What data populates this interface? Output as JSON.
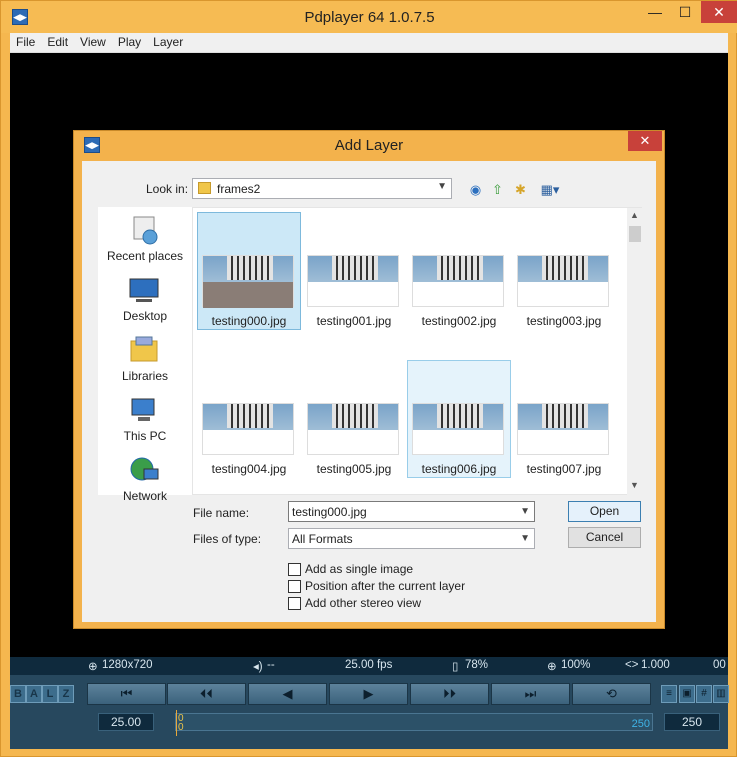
{
  "window": {
    "title": "Pdplayer 64 1.0.7.5",
    "controls": {
      "minimize": "—",
      "maximize": "☐",
      "close": "✕"
    }
  },
  "menu": [
    "File",
    "Edit",
    "View",
    "Play",
    "Layer"
  ],
  "status": {
    "resolution": "1280x720",
    "audio": "--",
    "fps": "25.00 fps",
    "opacity": "78%",
    "zoom": "100%",
    "aspect": "1.000",
    "timecode": "00"
  },
  "controls": {
    "modes": [
      "B",
      "A",
      "L",
      "Z"
    ],
    "playback": [
      "⏮",
      "⏴⏴",
      "◀",
      "▶",
      "⏵⏵",
      "⏭",
      "⟲"
    ],
    "start_frame": "25.00",
    "timeline_start": "0",
    "timeline_start2": "0",
    "timeline_end": "250",
    "end_frame": "250"
  },
  "dialog": {
    "title": "Add Layer",
    "close": "✕",
    "look_in_label": "Look in:",
    "look_in_value": "frames2",
    "places": [
      {
        "label": "Recent places",
        "icon": "recent-places-icon"
      },
      {
        "label": "Desktop",
        "icon": "desktop-icon"
      },
      {
        "label": "Libraries",
        "icon": "libraries-icon"
      },
      {
        "label": "This PC",
        "icon": "this-pc-icon"
      },
      {
        "label": "Network",
        "icon": "network-icon"
      }
    ],
    "files": [
      {
        "name": "testing000.jpg",
        "state": "selected"
      },
      {
        "name": "testing001.jpg",
        "state": ""
      },
      {
        "name": "testing002.jpg",
        "state": ""
      },
      {
        "name": "testing003.jpg",
        "state": ""
      },
      {
        "name": "testing004.jpg",
        "state": ""
      },
      {
        "name": "testing005.jpg",
        "state": ""
      },
      {
        "name": "testing006.jpg",
        "state": "hover"
      },
      {
        "name": "testing007.jpg",
        "state": ""
      }
    ],
    "file_name_label": "File name:",
    "file_name_value": "testing000.jpg",
    "file_type_label": "Files of type:",
    "file_type_value": "All Formats",
    "open_label": "Open",
    "cancel_label": "Cancel",
    "options": [
      {
        "label": "Add as single image",
        "checked": false
      },
      {
        "label": "Position after the current layer",
        "checked": false
      },
      {
        "label": "Add other stereo view",
        "checked": false
      }
    ]
  }
}
